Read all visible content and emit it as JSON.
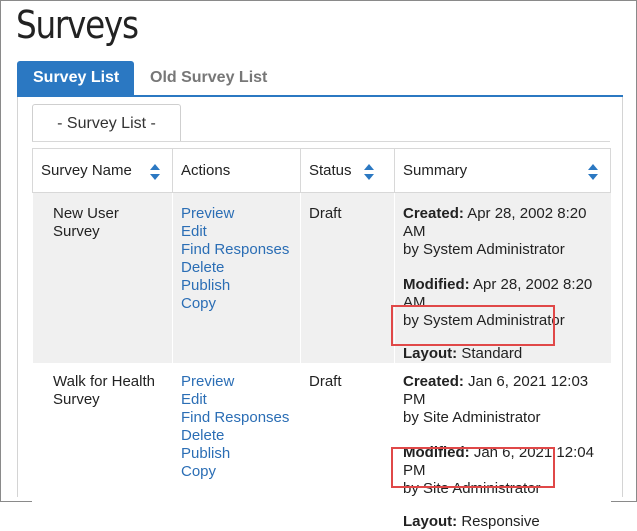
{
  "page": {
    "title": "Surveys"
  },
  "tabs": [
    {
      "label": "Survey List",
      "active": true
    },
    {
      "label": "Old Survey List",
      "active": false
    }
  ],
  "subtab": {
    "label": "- Survey List -"
  },
  "table": {
    "headers": {
      "name": "Survey Name",
      "actions": "Actions",
      "status": "Status",
      "summary": "Summary"
    },
    "rows": [
      {
        "name": "New User Survey",
        "actions": [
          "Preview",
          "Edit",
          "Find Responses",
          "Delete",
          "Publish",
          "Copy"
        ],
        "status": "Draft",
        "created_label": "Created:",
        "created_value": " Apr 28, 2002 8:20 AM",
        "created_by": "by System Administrator",
        "modified_label": "Modified:",
        "modified_value": " Apr 28, 2002 8:20 AM",
        "modified_by": "by System Administrator",
        "layout_label": "Layout:",
        "layout_value": " Standard"
      },
      {
        "name": "Walk for Health Survey",
        "actions": [
          "Preview",
          "Edit",
          "Find Responses",
          "Delete",
          "Publish",
          "Copy"
        ],
        "status": "Draft",
        "created_label": "Created:",
        "created_value": " Jan 6, 2021 12:03 PM",
        "created_by": "by Site Administrator",
        "modified_label": "Modified:",
        "modified_value": " Jan 6, 2021 12:04 PM",
        "modified_by": "by Site Administrator",
        "layout_label": "Layout:",
        "layout_value": " Responsive"
      }
    ]
  },
  "colors": {
    "accent": "#2b78c2",
    "link": "#2b6eb5",
    "highlight": "#e04848"
  },
  "icons": {
    "sort": "sort-updown-icon"
  }
}
